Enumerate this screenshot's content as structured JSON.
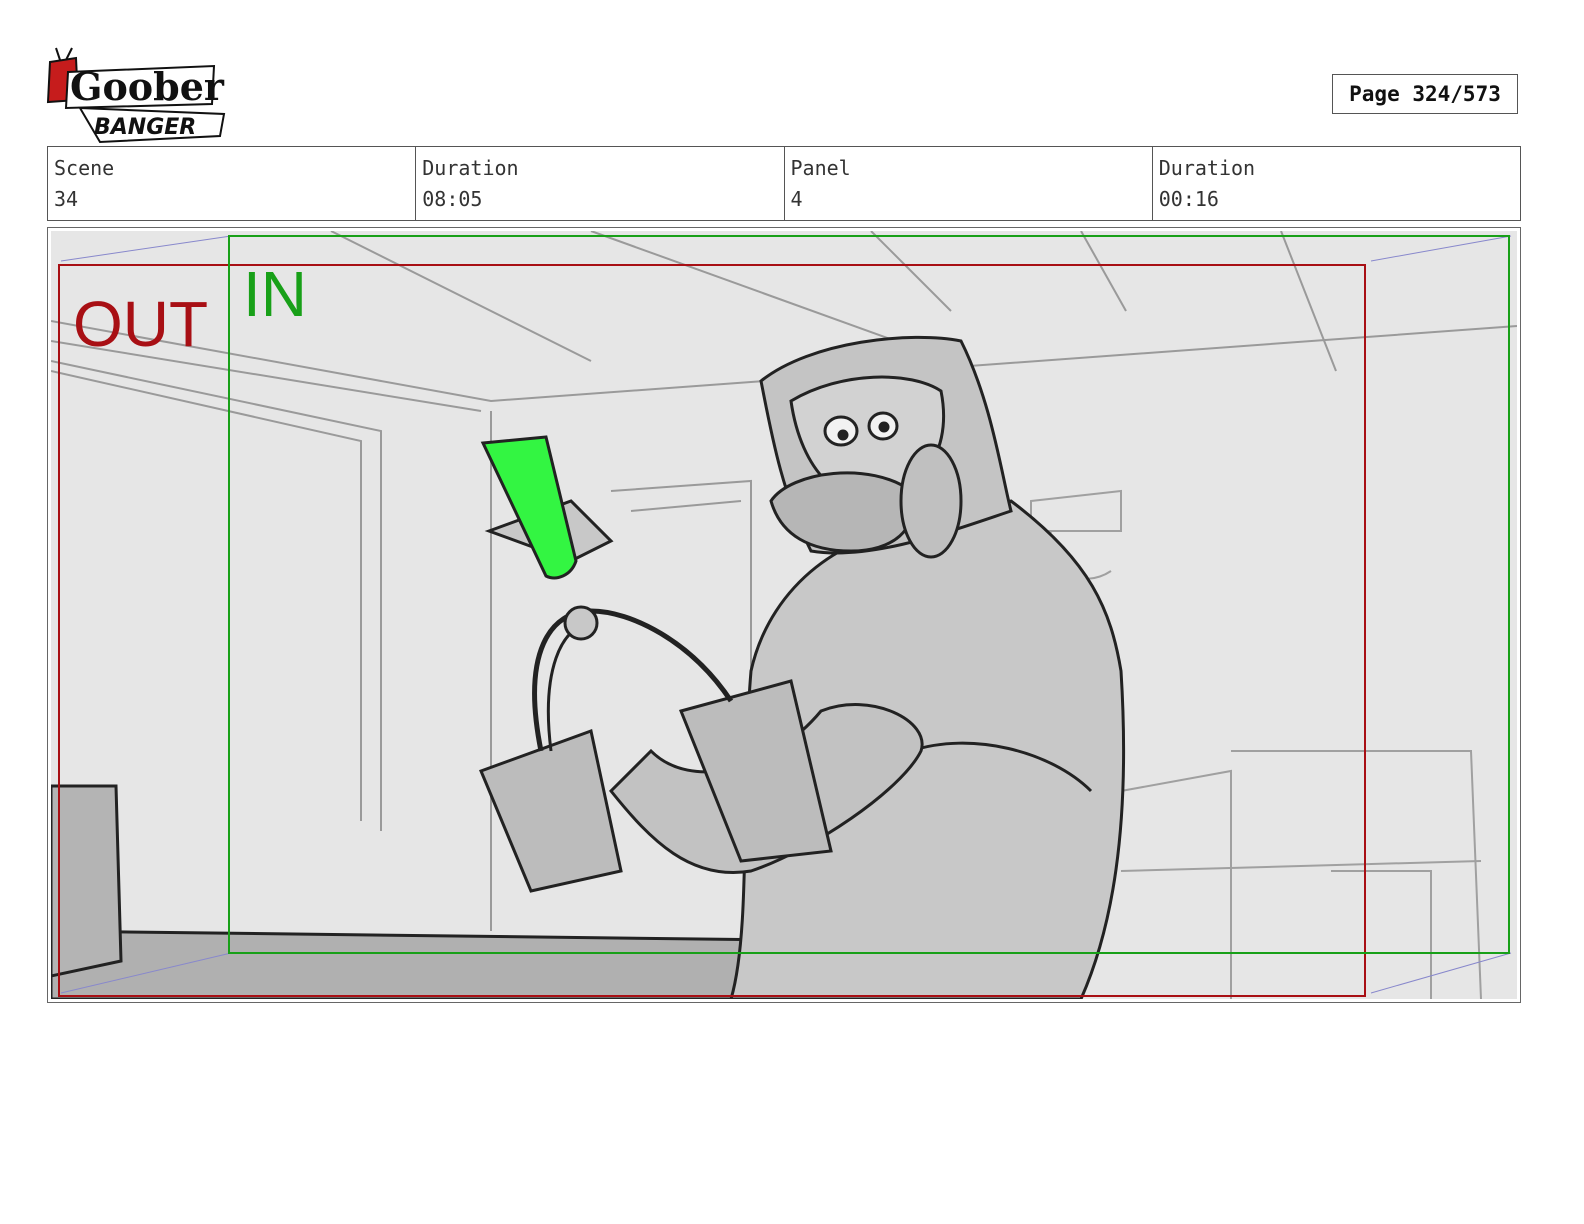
{
  "logo": {
    "text_main": "Goober",
    "text_sub": "BANGER"
  },
  "page": {
    "label": "Page 324/573"
  },
  "info": {
    "scene_label": "Scene",
    "scene_value": "34",
    "scene_duration_label": "Duration",
    "scene_duration_value": "08:05",
    "panel_label": "Panel",
    "panel_value": "4",
    "panel_duration_label": "Duration",
    "panel_duration_value": "00:16"
  },
  "frame": {
    "out_label": "OUT",
    "in_label": "IN",
    "out_color": "#a80f14",
    "in_color": "#18a018",
    "accent_color": "#33f542"
  }
}
